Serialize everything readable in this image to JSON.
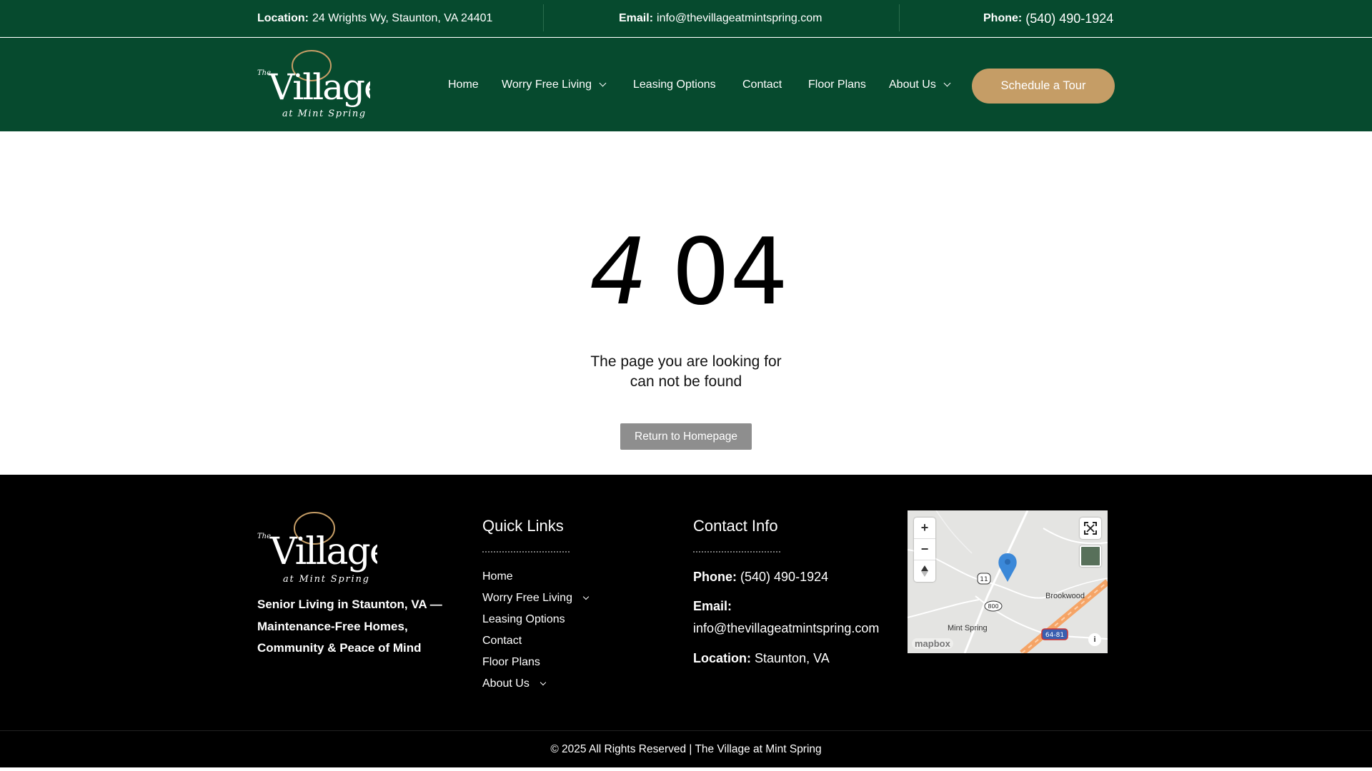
{
  "topbar": {
    "location_label": "Location:",
    "location_value": "24 Wrights Wy, Staunton, VA 24401",
    "email_label": "Email:",
    "email_value": "info@thevillageatmintspring.com",
    "phone_label": "Phone:",
    "phone_value": "(540) 490-1924"
  },
  "logo": {
    "the": "The",
    "village": "Village",
    "sub": "at Mint Spring"
  },
  "nav": {
    "items": [
      {
        "label": "Home"
      },
      {
        "label": "Worry Free Living"
      },
      {
        "label": "Leasing Options"
      },
      {
        "label": "Contact"
      },
      {
        "label": "Floor Plans"
      },
      {
        "label": "About Us"
      }
    ],
    "cta": "Schedule a Tour"
  },
  "error": {
    "digit_first": "4",
    "digit_rest": "04",
    "message_line1": "The page you are looking for",
    "message_line2": "can not be found",
    "button": "Return to Homepage"
  },
  "footer": {
    "tagline": "Senior Living in Staunton, VA — Maintenance-Free Homes, Community & Peace of Mind",
    "quick_links_title": "Quick Links",
    "quick_links": [
      {
        "label": "Home"
      },
      {
        "label": "Worry Free Living"
      },
      {
        "label": "Leasing Options"
      },
      {
        "label": "Contact"
      },
      {
        "label": "Floor Plans"
      },
      {
        "label": "About Us"
      }
    ],
    "contact_title": "Contact Info",
    "phone_label": "Phone:",
    "phone_value": "(540) 490-1924",
    "email_label": "Email:",
    "email_value": "info@thevillageatmintspring.com",
    "location_label": "Location:",
    "location_value": "Staunton, VA"
  },
  "map": {
    "zoom_in": "+",
    "zoom_out": "−",
    "label_brookwood": "Brookwood",
    "label_mintspring": "Mint Spring",
    "route_11": "11",
    "route_800": "800",
    "route_64_81": "64-81",
    "attribution": "mapbox",
    "info": "i"
  },
  "copyright": "© 2025 All Rights Reserved | The Village at Mint Spring",
  "colors": {
    "brand_green": "#064a2e",
    "accent_gold": "#c59d66",
    "button_gray": "#8e8e8e",
    "footer_black": "#000000"
  }
}
